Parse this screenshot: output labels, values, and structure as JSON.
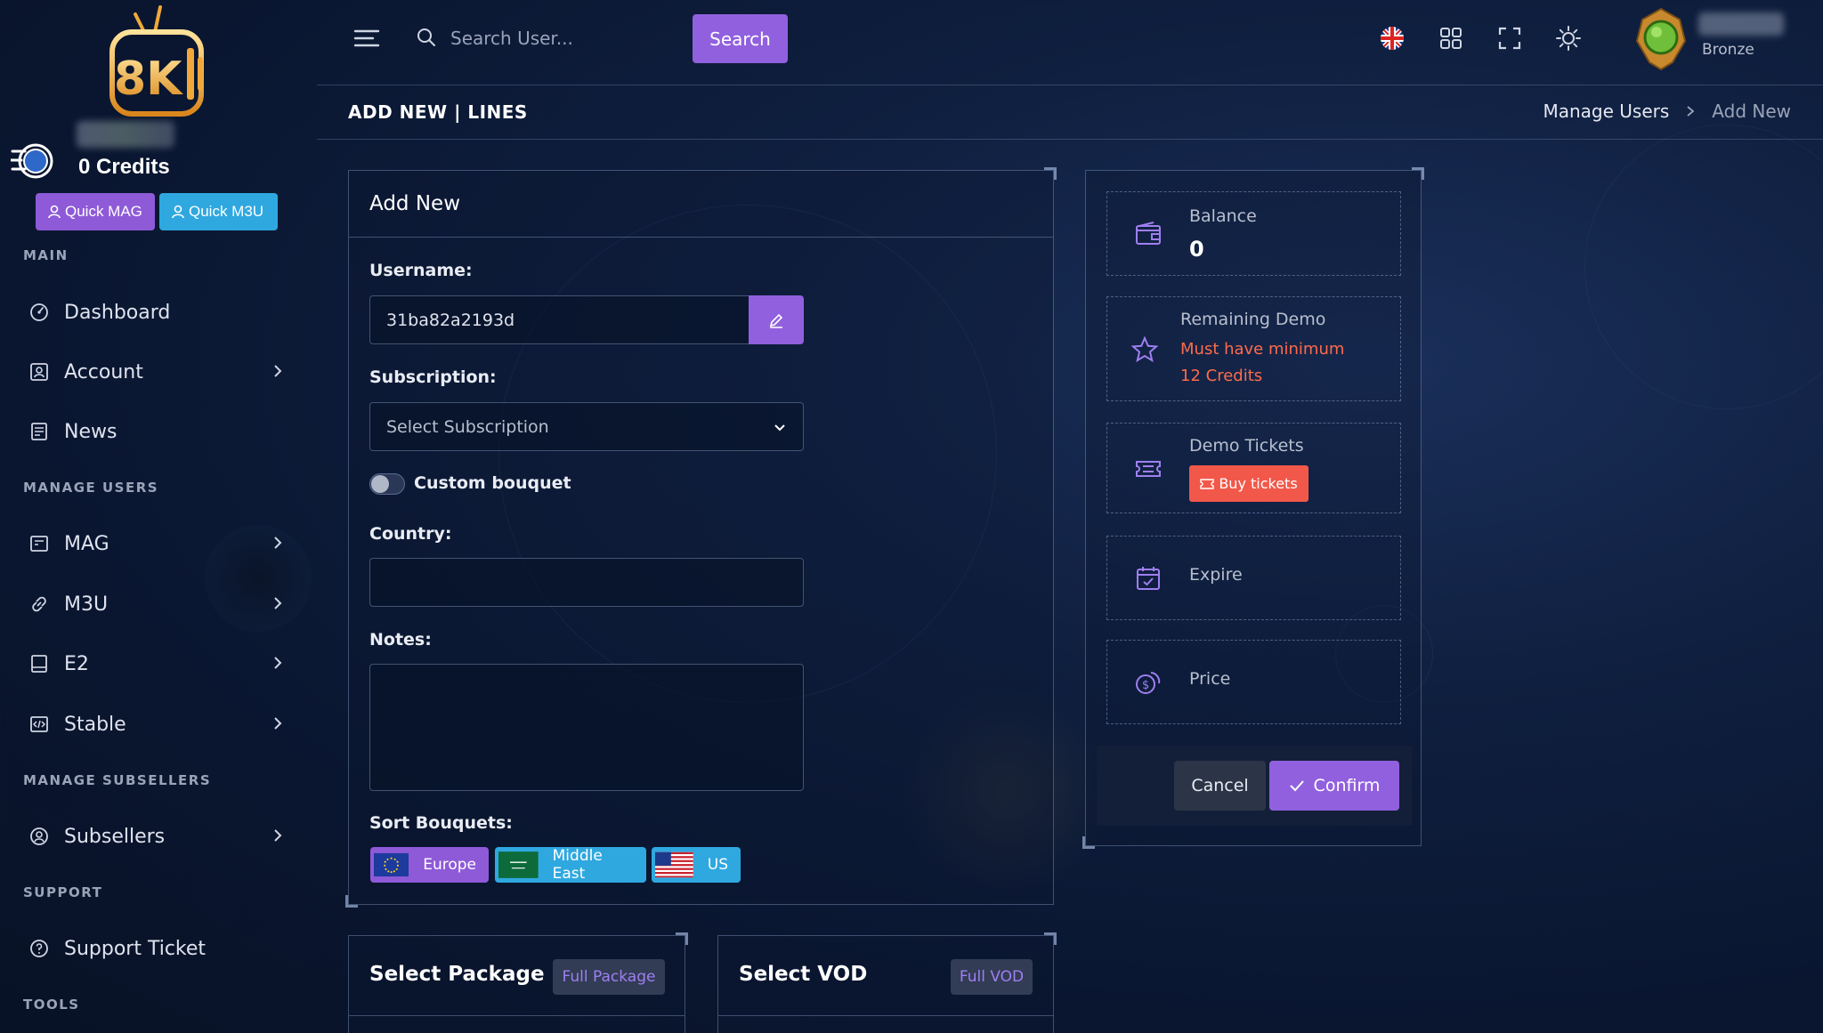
{
  "sidebar": {
    "credits": "0 Credits",
    "quick_mag": "Quick MAG",
    "quick_m3u": "Quick M3U",
    "sections": {
      "main": "MAIN",
      "manage_users": "MANAGE USERS",
      "manage_subsellers": "MANAGE SUBSELLERS",
      "support": "SUPPORT",
      "tools": "TOOLS"
    },
    "items": [
      {
        "label": "Dashboard",
        "icon": "dashboard-icon"
      },
      {
        "label": "Account",
        "icon": "account-icon"
      },
      {
        "label": "News",
        "icon": "news-icon"
      },
      {
        "label": "MAG",
        "icon": "mag-icon"
      },
      {
        "label": "M3U",
        "icon": "m3u-icon"
      },
      {
        "label": "E2",
        "icon": "e2-icon"
      },
      {
        "label": "Stable",
        "icon": "stable-icon"
      },
      {
        "label": "Subsellers",
        "icon": "subsellers-icon"
      },
      {
        "label": "Support Ticket",
        "icon": "support-icon"
      }
    ]
  },
  "topbar": {
    "search_placeholder": "Search User...",
    "search_button": "Search",
    "rank": "Bronze"
  },
  "header": {
    "title": "ADD NEW | LINES",
    "breadcrumb": [
      "Manage Users",
      "Add New"
    ]
  },
  "form": {
    "card_title": "Add New",
    "username_label": "Username:",
    "username_value": "31ba82a2193d",
    "subscription_label": "Subscription:",
    "subscription_value": "Select Subscription",
    "custom_bouquet_label": "Custom bouquet",
    "country_label": "Country:",
    "country_value": "",
    "notes_label": "Notes:",
    "notes_value": "",
    "sort_label": "Sort Bouquets:",
    "bouquets": [
      "Europe",
      "Middle East",
      "US"
    ]
  },
  "summary": {
    "balance_label": "Balance",
    "balance_value": "0",
    "demo_label": "Remaining Demo",
    "demo_warning": "Must have minimum 12 Credits",
    "tickets_label": "Demo Tickets",
    "buy_tickets": "Buy tickets",
    "expire_label": "Expire",
    "price_label": "Price",
    "cancel": "Cancel",
    "confirm": "Confirm"
  },
  "packages": {
    "package_title": "Select Package",
    "package_badge": "Full Package",
    "vod_title": "Select VOD",
    "vod_badge": "Full VOD"
  },
  "colors": {
    "purple": "#9160de",
    "cyan": "#2fa8e0",
    "warning": "#ff6b4a",
    "ticket_red": "#f2584a"
  }
}
